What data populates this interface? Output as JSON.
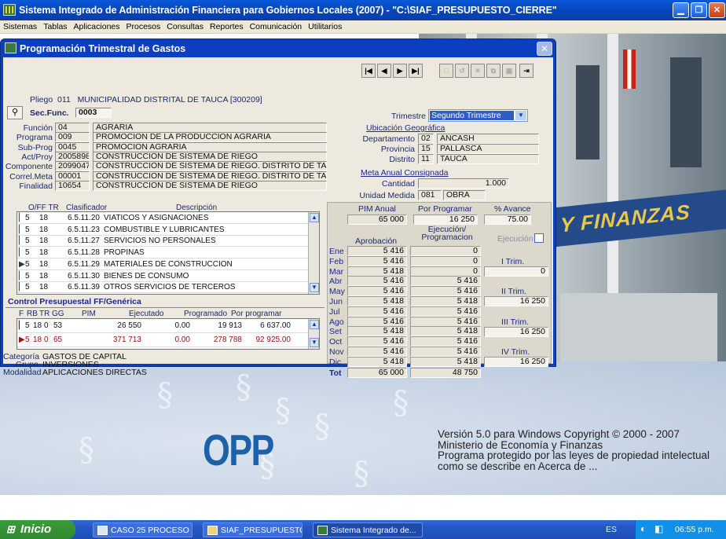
{
  "window": {
    "title": "Sistema Integrado de Administración Financiera para Gobiernos Locales (2007) - \"C:\\SIAF_PRESUPUESTO_CIERRE\""
  },
  "menu": [
    "Sistemas",
    "Tablas",
    "Aplicaciones",
    "Procesos",
    "Consultas",
    "Reportes",
    "Comunicación",
    "Utilitarios"
  ],
  "dialog": {
    "title": "Programación Trimestral de Gastos",
    "pliego_label": "Pliego",
    "pliego_code": "011",
    "pliego_name": "MUNICIPALIDAD DISTRITAL DE TAUCA [300209]",
    "secfunc_label": "Sec.Func.",
    "secfunc_value": "0003",
    "trimestre_label": "Trimestre",
    "trimestre_value": "Segundo Trimestre",
    "left_fields": [
      {
        "label": "Función",
        "code": "04",
        "desc": "AGRARIA"
      },
      {
        "label": "Programa",
        "code": "009",
        "desc": "PROMOCION DE LA PRODUCCION AGRARIA"
      },
      {
        "label": "Sub-Prog",
        "code": "0045",
        "desc": "PROMOCION AGRARIA"
      },
      {
        "label": "Act/Proy",
        "code": "2005898",
        "desc": "CONSTRUCCION DE SISTEMA DE RIEGO"
      },
      {
        "label": "Componente",
        "code": "2099047",
        "desc": "CONSTRUCCION DE SISTEMA DE RIEGO. DISTRITO DE TAUCA"
      },
      {
        "label": "Correl.Meta",
        "code": "00001",
        "desc": "CONSTRUCCION DE SISTEMA DE RIEGO. DISTRITO DE TAUCA"
      },
      {
        "label": "Finalidad",
        "code": "10654",
        "desc": "CONSTRUCCION DE SISTEMA DE RIEGO"
      }
    ],
    "ubicacion": {
      "title": "Ubicación Geográfica",
      "rows": [
        {
          "label": "Departamento",
          "code": "02",
          "name": "ANCASH"
        },
        {
          "label": "Provincia",
          "code": "15",
          "name": "PALLASCA"
        },
        {
          "label": "Distrito",
          "code": "11",
          "name": "TAUCA"
        }
      ]
    },
    "meta": {
      "title": "Meta Anual Consignada",
      "cantidad_label": "Cantidad",
      "cantidad": "1.000",
      "unidad_label": "Unidad Medida",
      "unidad_code": "081",
      "unidad_name": "OBRA"
    },
    "clasif": {
      "headers": [
        "O/FF",
        "TR",
        "Clasificador",
        "Descripción"
      ],
      "rows": [
        {
          "o": "5",
          "tr": "18",
          "cl": "6.5.11.20",
          "d": "VIATICOS Y ASIGNACIONES"
        },
        {
          "o": "5",
          "tr": "18",
          "cl": "6.5.11.23",
          "d": "COMBUSTIBLE Y LUBRICANTES"
        },
        {
          "o": "5",
          "tr": "18",
          "cl": "6.5.11.27",
          "d": "SERVICIOS NO PERSONALES"
        },
        {
          "o": "5",
          "tr": "18",
          "cl": "6.5.11.28",
          "d": "PROPINAS"
        },
        {
          "o": "5",
          "tr": "18",
          "cl": "6.5.11.29",
          "d": "MATERIALES DE CONSTRUCCION"
        },
        {
          "o": "5",
          "tr": "18",
          "cl": "6.5.11.30",
          "d": "BIENES DE CONSUMO"
        },
        {
          "o": "5",
          "tr": "18",
          "cl": "6.5.11.39",
          "d": "OTROS SERVICIOS DE TERCEROS"
        }
      ]
    },
    "control": {
      "title": "Control Presupuestal FF/Genérica",
      "headers": [
        "F",
        "RB",
        "TR",
        "GG",
        "PIM",
        "Ejecutado",
        "Programado",
        "Por programar"
      ],
      "rows": [
        {
          "f": "5",
          "rb": "18",
          "tr": "0",
          "gg": "53",
          "pim": "26 550",
          "ej": "0.00",
          "prog": "19 913",
          "pp": "6 637.00"
        },
        {
          "f": "5",
          "rb": "18",
          "tr": "0",
          "gg": "65",
          "pim": "371 713",
          "ej": "0.00",
          "prog": "278 788",
          "pp": "92 925.00"
        }
      ]
    },
    "categoria": {
      "cat_label": "Categoría",
      "cat": "GASTOS DE CAPITAL",
      "grupo_label": "Grupo",
      "grupo": "INVERSIONES",
      "mod_label": "Modalidad",
      "mod": "APLICACIONES DIRECTAS"
    },
    "summary": {
      "pim_label": "PIM Anual",
      "pim": "65 000",
      "porprog_label": "Por Programar",
      "porprog": "16 250",
      "avance_label": "% Avance",
      "avance": "75.00"
    },
    "monthly": {
      "aprob_label": "Aprobación",
      "ejec_label": "Ejecución/ Programacion",
      "ejec_chk_label": "Ejecución",
      "rows": [
        {
          "m": "Ene",
          "a": "5 416",
          "e": "0"
        },
        {
          "m": "Feb",
          "a": "5 416",
          "e": "0"
        },
        {
          "m": "Mar",
          "a": "5 418",
          "e": "0"
        },
        {
          "m": "Abr",
          "a": "5 416",
          "e": "5 416"
        },
        {
          "m": "May",
          "a": "5 416",
          "e": "5 416"
        },
        {
          "m": "Jun",
          "a": "5 418",
          "e": "5 418"
        },
        {
          "m": "Jul",
          "a": "5 416",
          "e": "5 416"
        },
        {
          "m": "Ago",
          "a": "5 416",
          "e": "5 416"
        },
        {
          "m": "Set",
          "a": "5 418",
          "e": "5 418"
        },
        {
          "m": "Oct",
          "a": "5 416",
          "e": "5 416"
        },
        {
          "m": "Nov",
          "a": "5 416",
          "e": "5 416"
        },
        {
          "m": "Dic",
          "a": "5 418",
          "e": "5 418"
        }
      ],
      "tot_label": "Tot",
      "tot_a": "65 000",
      "tot_e": "48 750"
    },
    "trims": [
      {
        "label": "I Trim.",
        "value": "0"
      },
      {
        "label": "II Trim.",
        "value": "16 250"
      },
      {
        "label": "III Trim.",
        "value": "16 250"
      },
      {
        "label": "IV Trim.",
        "value": "16 250"
      }
    ]
  },
  "desktop": {
    "logo": "OPP",
    "banner": "Y FINANZAS",
    "version": [
      "Versión 5.0 para Windows Copyright © 2000 - 2007",
      "Ministerio de Economía y Finanzas",
      "Programa protegido por las leyes de propiedad intelectual",
      "como se describe en Acerca de ..."
    ]
  },
  "taskbar": {
    "start": "Inicio",
    "items": [
      "CASO 25 PROCESO ...",
      "SIAF_PRESUPUESTO...",
      "Sistema Integrado de..."
    ],
    "lang": "ES",
    "time": "06:55 p.m."
  }
}
